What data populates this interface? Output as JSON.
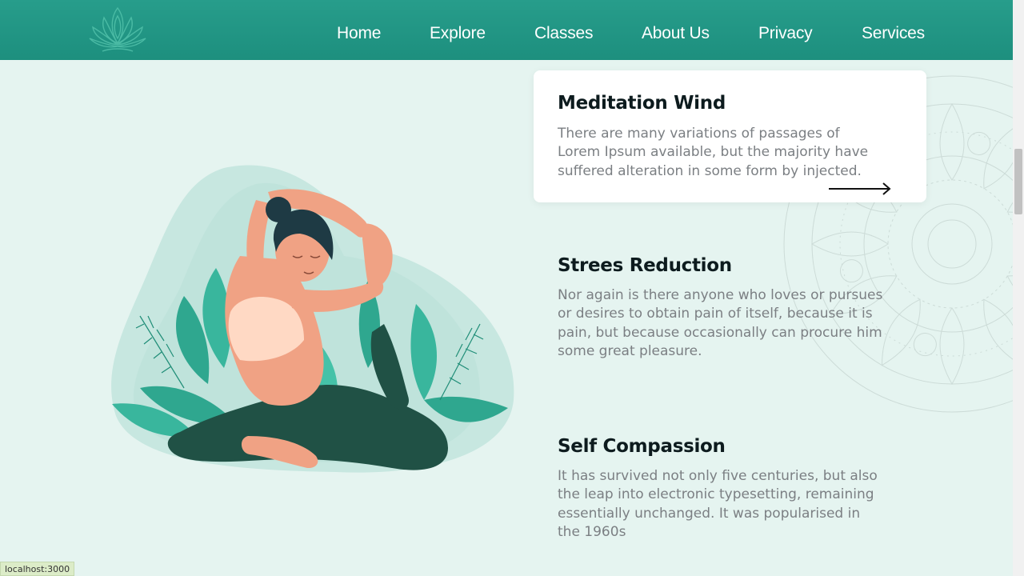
{
  "nav": {
    "logo_icon": "lotus-icon",
    "links": [
      "Home",
      "Explore",
      "Classes",
      "About Us",
      "Privacy",
      "Services"
    ]
  },
  "features": [
    {
      "title": "Meditation Wind",
      "text": "There are many variations of passages of Lorem Ipsum available, but the majority have suffered alteration in some form by injected.",
      "action_icon": "arrow-right-icon"
    },
    {
      "title": "Strees Reduction",
      "text": "Nor again is there anyone who loves or pursues or desires to obtain pain of itself, because it is pain, but because occasionally can procure him some great pleasure."
    },
    {
      "title": "Self Compassion",
      "text": "It has survived not only five centuries, but also the leap into electronic typesetting, remaining essentially unchanged. It was popularised in the 1960s"
    }
  ],
  "status_bar": "localhost:3000",
  "colors": {
    "nav_bg": "#21968a",
    "page_bg": "#e5f4f0",
    "heading": "#0d1b1e",
    "body_text": "#7b7f83"
  }
}
